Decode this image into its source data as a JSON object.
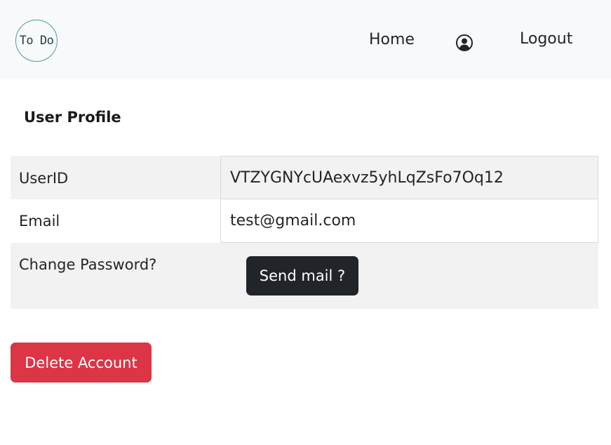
{
  "navbar": {
    "logo_text": "To Do",
    "home_label": "Home",
    "user_icon": "user-circle-icon",
    "logout_label": "Logout"
  },
  "profile": {
    "title": "User Profile",
    "rows": [
      {
        "label": "UserID",
        "value": "VTZYGNYcUAexvz5yhLqZsFo7Oq12"
      },
      {
        "label": "Email",
        "value": "test@gmail.com"
      },
      {
        "label": "Change Password?",
        "button": "Send mail ?"
      }
    ]
  },
  "delete_label": "Delete Account",
  "colors": {
    "navbar_bg": "#f8f9fa",
    "dark_button": "#212529",
    "danger_button": "#dc3545",
    "row_stripe": "#f2f2f2",
    "logo_ring": "#4a9aa8"
  }
}
